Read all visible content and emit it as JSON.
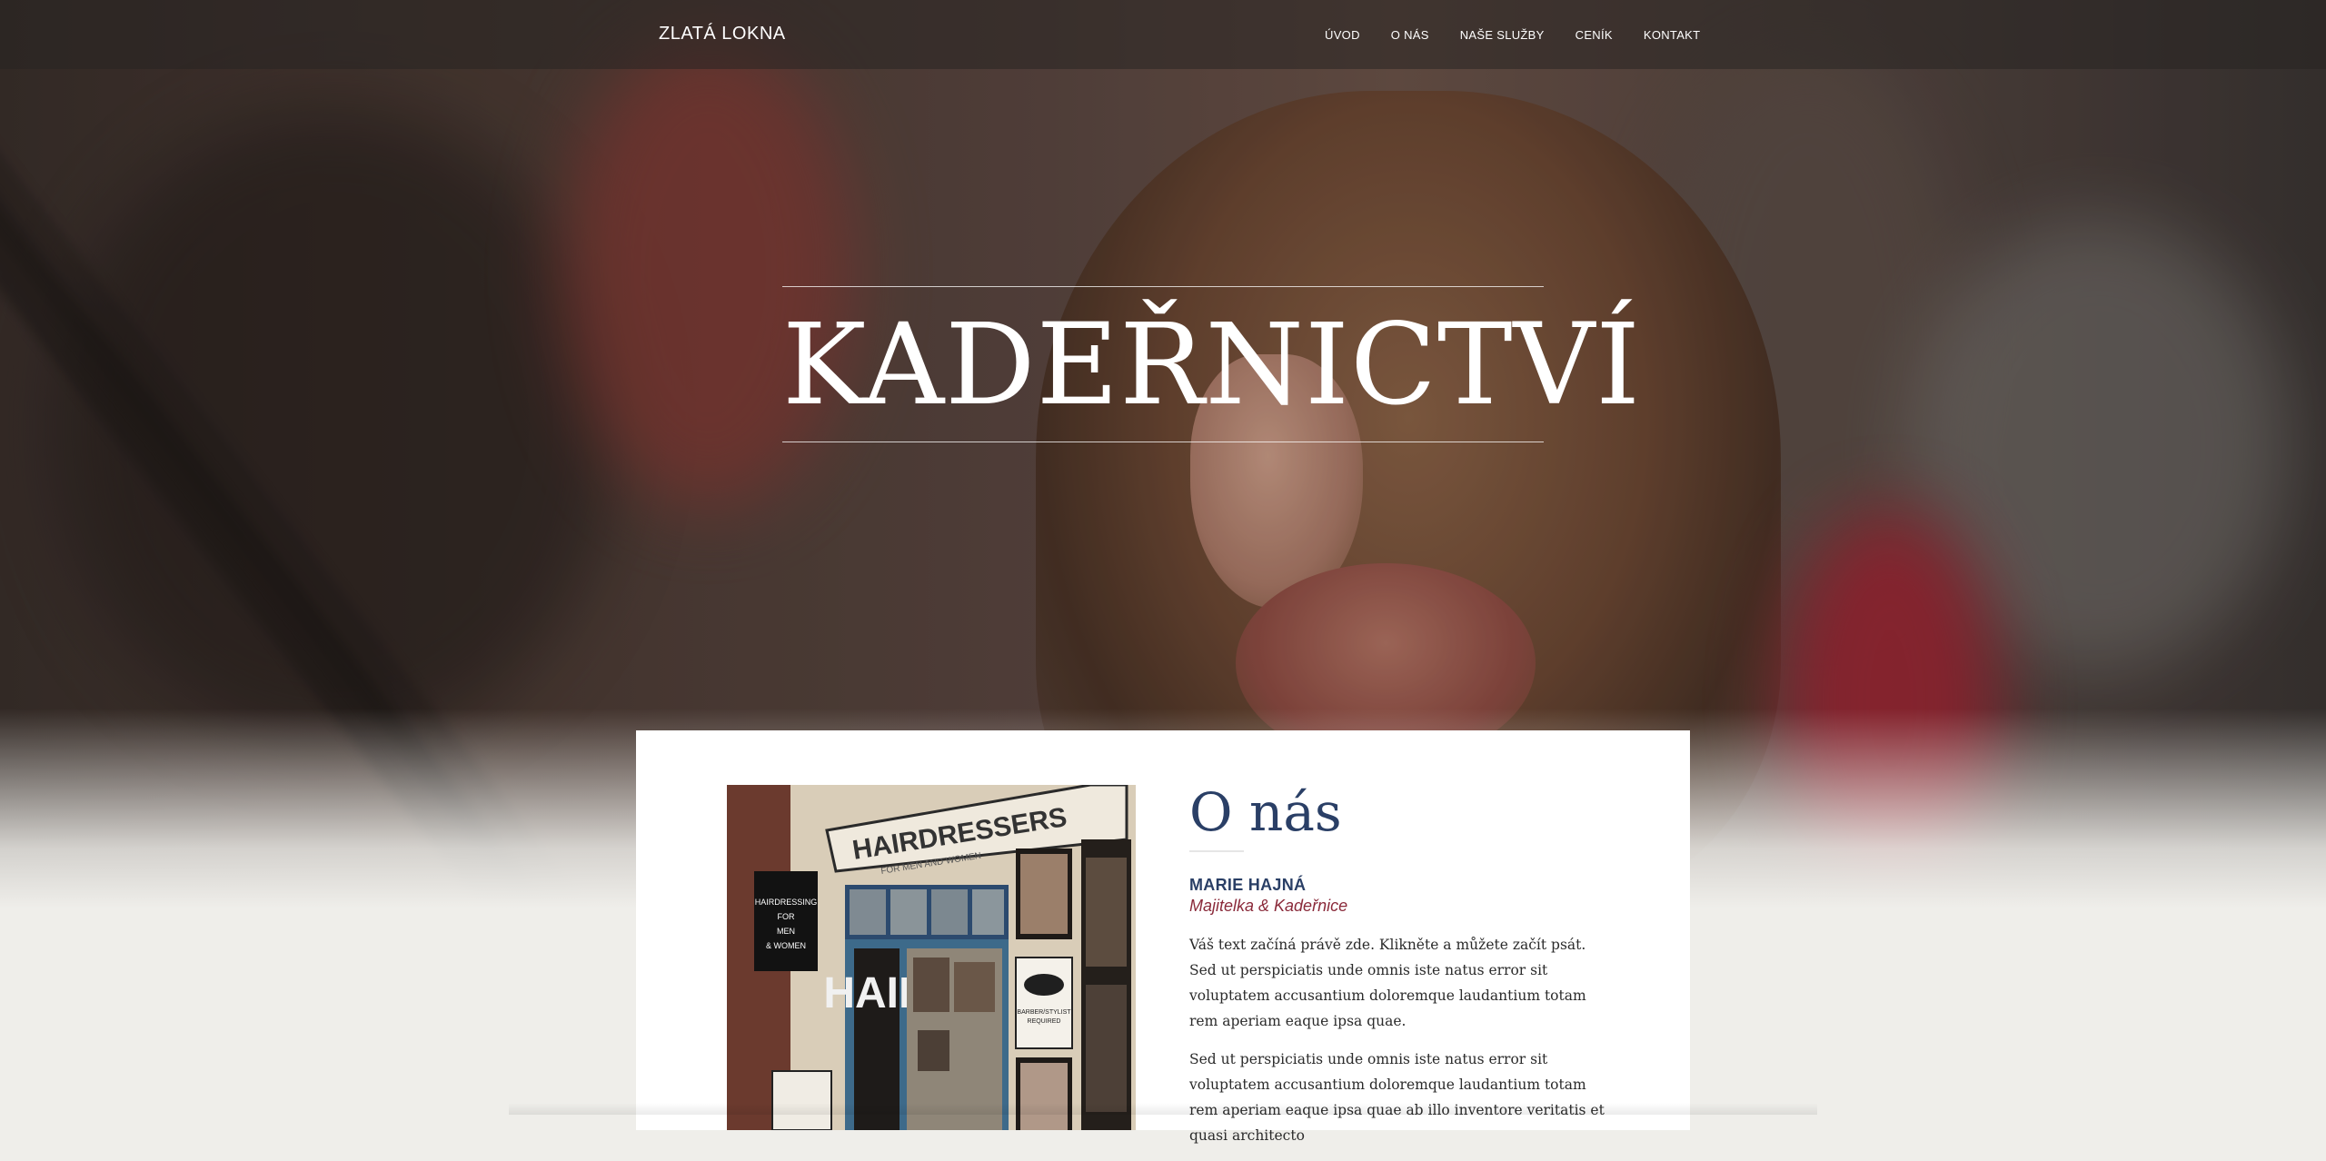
{
  "brand": "ZLATÁ LOKNA",
  "nav": {
    "items": [
      "ÚVOD",
      "O NÁS",
      "NAŠE SLUŽBY",
      "CENÍK",
      "KONTAKT"
    ]
  },
  "hero": {
    "title": "KADEŘNICTVÍ"
  },
  "about": {
    "title": "O nás",
    "person_name": "MARIE HAJNÁ",
    "person_role": "Majitelka & Kadeřnice",
    "paragraphs": [
      "Váš text začíná právě zde. Klikněte a můžete začít psát. Sed ut perspiciatis unde omnis iste natus error sit voluptatem accusantium doloremque laudantium totam rem aperiam eaque ipsa quae.",
      "Sed ut perspiciatis unde omnis iste natus error sit voluptatem accusantium doloremque laudantium totam rem aperiam eaque ipsa quae ab illo inventore veritatis et quasi architecto"
    ],
    "photo": {
      "sign_text": "HAIRDRESSERS",
      "sign_subtext": "FOR MEN AND WOMEN",
      "hanging_sign": [
        "HAIRDRESSING",
        "FOR",
        "MEN",
        "& WOMEN"
      ],
      "window_letters": "HAIR",
      "window_notice": [
        "BARBER/STYLIST",
        "REQUIRED"
      ]
    }
  },
  "colors": {
    "heading_blue": "#2a3f66",
    "role_red": "#8a2a3a",
    "nav_text": "#ffffff",
    "page_bg": "#efeeea"
  }
}
